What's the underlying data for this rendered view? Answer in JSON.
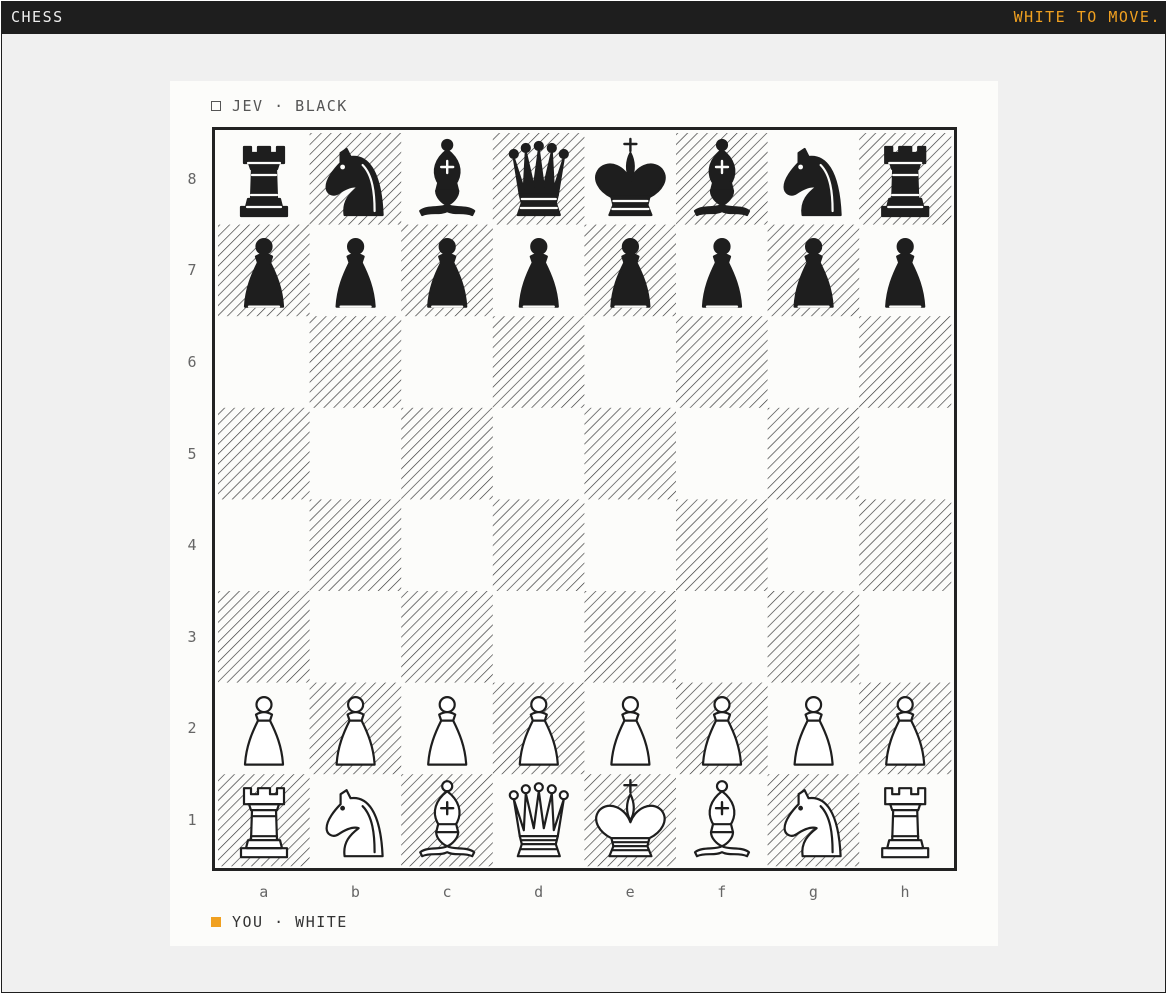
{
  "window": {
    "title": "CHESS",
    "status": "WHITE TO MOVE."
  },
  "players": {
    "opponent": "JEV · BLACK",
    "self": "YOU · WHITE"
  },
  "board": {
    "files": [
      "a",
      "b",
      "c",
      "d",
      "e",
      "f",
      "g",
      "h"
    ],
    "ranks": [
      "8",
      "7",
      "6",
      "5",
      "4",
      "3",
      "2",
      "1"
    ],
    "position": [
      [
        "bR",
        "bN",
        "bB",
        "bQ",
        "bK",
        "bB",
        "bN",
        "bR"
      ],
      [
        "bP",
        "bP",
        "bP",
        "bP",
        "bP",
        "bP",
        "bP",
        "bP"
      ],
      [
        "",
        "",
        "",
        "",
        "",
        "",
        "",
        ""
      ],
      [
        "",
        "",
        "",
        "",
        "",
        "",
        "",
        ""
      ],
      [
        "",
        "",
        "",
        "",
        "",
        "",
        "",
        ""
      ],
      [
        "",
        "",
        "",
        "",
        "",
        "",
        "",
        ""
      ],
      [
        "wP",
        "wP",
        "wP",
        "wP",
        "wP",
        "wP",
        "wP",
        "wP"
      ],
      [
        "wR",
        "wN",
        "wB",
        "wQ",
        "wK",
        "wB",
        "wN",
        "wR"
      ]
    ]
  },
  "colors": {
    "accent": "#f0a020",
    "ink": "#1e1e1e",
    "board_light": "#fcfcfa"
  }
}
